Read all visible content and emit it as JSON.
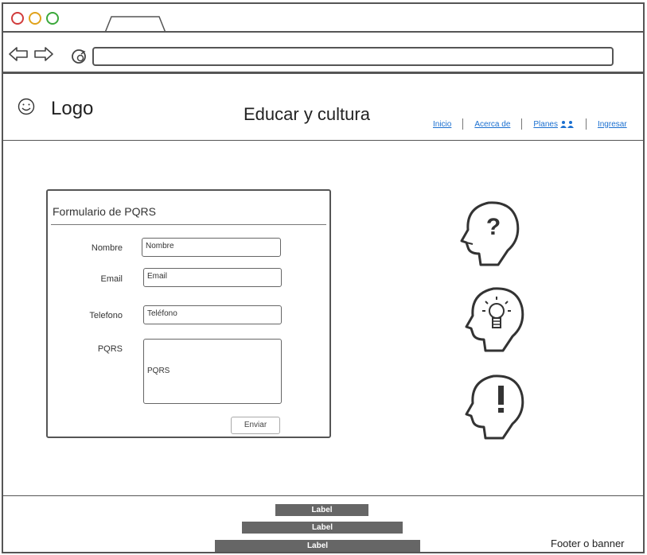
{
  "window": {
    "dots": [
      {
        "name": "close",
        "color": "#d13b3b"
      },
      {
        "name": "minimize",
        "color": "#e0a21b"
      },
      {
        "name": "maximize",
        "color": "#3aa83a"
      }
    ]
  },
  "header": {
    "logo": "Logo",
    "title": "Educar y cultura",
    "links": [
      {
        "label": "Inicio"
      },
      {
        "label": "Acerca de"
      },
      {
        "label": "Planes"
      },
      {
        "label": "Ingresar"
      }
    ]
  },
  "form": {
    "title": "Formulario de PQRS",
    "name_label": "Nombre",
    "name_placeholder": "Nombre",
    "email_label": "Email",
    "email_placeholder": "Email",
    "phone_label": "Telefono",
    "phone_placeholder": "Teléfono",
    "pqrs_label": "PQRS",
    "pqrs_placeholder": "PQRS",
    "submit_label": "Enviar"
  },
  "footer": {
    "labels": [
      "Label",
      "Label",
      "Label"
    ],
    "text": "Footer o banner"
  },
  "colors": {
    "link": "#1a6fd0",
    "frame": "#555555",
    "label_bar": "#666666"
  },
  "icons": [
    "smiley-icon",
    "question-head-icon",
    "lightbulb-head-icon",
    "exclamation-head-icon",
    "back-arrow-icon",
    "forward-arrow-icon",
    "reload-icon",
    "people-icon"
  ]
}
